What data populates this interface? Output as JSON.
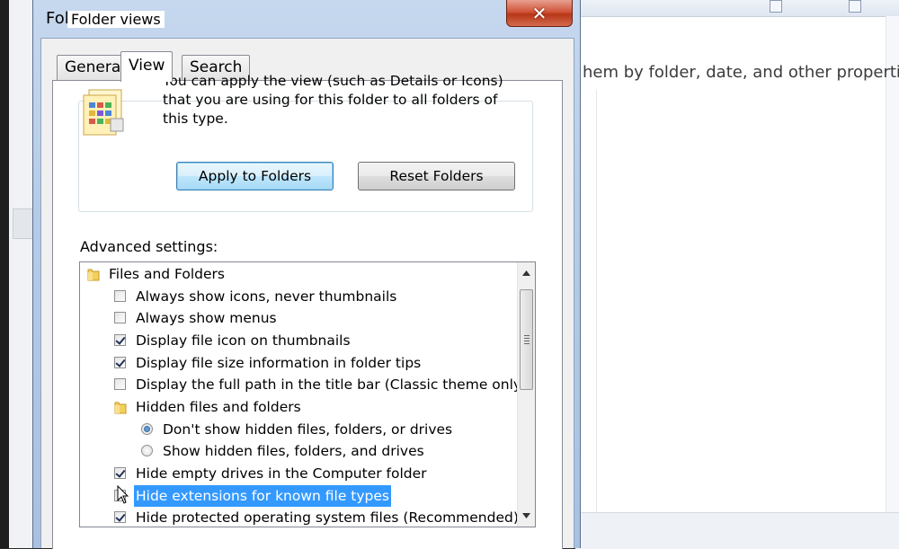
{
  "dialog": {
    "title": "Folder Options",
    "close_label": "✕",
    "tabs": [
      {
        "label": "General",
        "active": false
      },
      {
        "label": "View",
        "active": true
      },
      {
        "label": "Search",
        "active": false
      }
    ],
    "folder_views": {
      "label": "Folder views",
      "description": "You can apply the view (such as Details or Icons) that you are using for this folder to all folders of this type.",
      "apply_button": "Apply to Folders",
      "reset_button": "Reset Folders"
    },
    "advanced": {
      "label": "Advanced settings:",
      "items": [
        {
          "type": "folder",
          "label": "Files and Folders"
        },
        {
          "type": "checkbox",
          "label": "Always show icons, never thumbnails",
          "checked": false
        },
        {
          "type": "checkbox",
          "label": "Always show menus",
          "checked": false
        },
        {
          "type": "checkbox",
          "label": "Display file icon on thumbnails",
          "checked": true
        },
        {
          "type": "checkbox",
          "label": "Display file size information in folder tips",
          "checked": true
        },
        {
          "type": "checkbox",
          "label": "Display the full path in the title bar (Classic theme only)",
          "checked": false
        },
        {
          "type": "folder",
          "label": "Hidden files and folders"
        },
        {
          "type": "radio",
          "label": "Don't show hidden files, folders, or drives",
          "checked": true
        },
        {
          "type": "radio",
          "label": "Show hidden files, folders, and drives",
          "checked": false
        },
        {
          "type": "checkbox",
          "label": "Hide empty drives in the Computer folder",
          "checked": true
        },
        {
          "type": "checkbox",
          "label": "Hide extensions for known file types",
          "checked": false,
          "selected": true
        },
        {
          "type": "checkbox",
          "label": "Hide protected operating system files (Recommended)",
          "checked": true
        }
      ]
    }
  },
  "background": {
    "text": "hem by folder, date, and other properties."
  },
  "colors": {
    "selection": "#3399ff",
    "primary_button_border": "#3c7fb1",
    "close_button": "#c7462a"
  }
}
